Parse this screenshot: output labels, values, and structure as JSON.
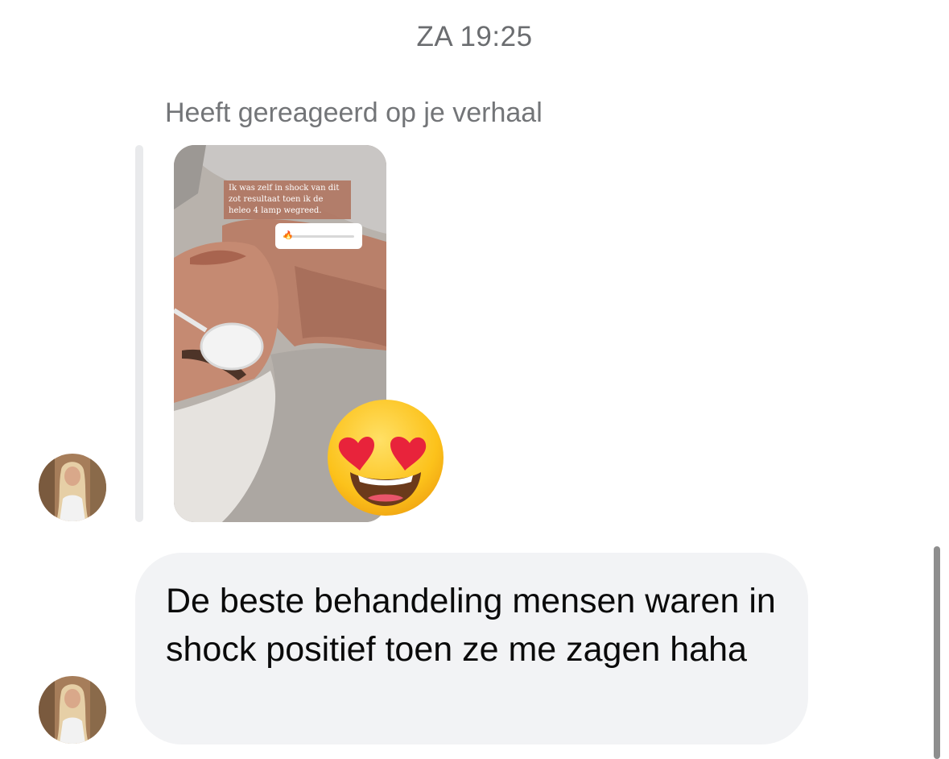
{
  "chat": {
    "timestamp": "ZA 19:25",
    "story_reply_label": "Heeft gereageerd op je verhaal",
    "story": {
      "caption": "Ik was zelf in shock van dit zot resultaat toen ik de heleo 4 lamp wegreed.",
      "slider_emoji": "🔥",
      "slider_value": 0.05
    },
    "reaction_emoji": "heart-eyes-emoji",
    "message_text": "De beste behandeling mensen waren in shock positief toen ze me zagen haha"
  },
  "colors": {
    "bubble_bg": "#f2f3f5",
    "meta_text": "#737578",
    "message_text": "#0a0a0a"
  }
}
